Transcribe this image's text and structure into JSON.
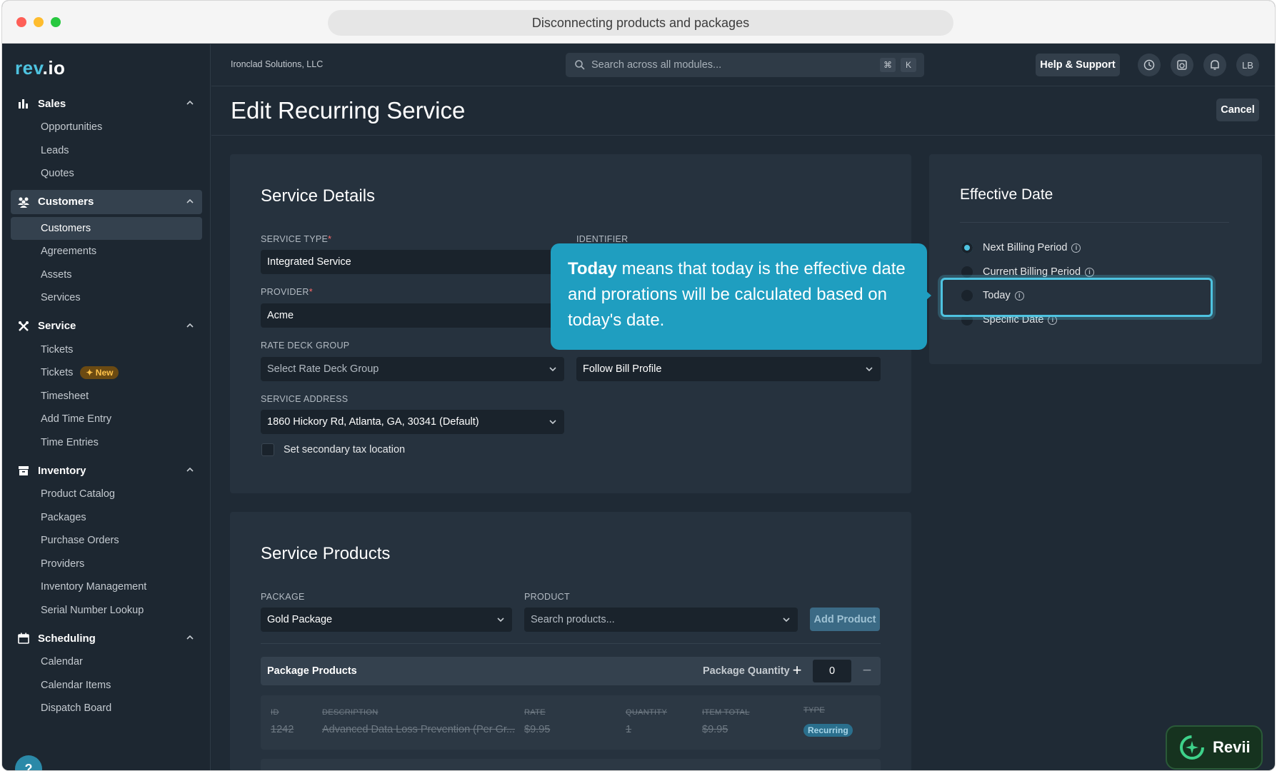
{
  "window": {
    "title": "Disconnecting products and packages"
  },
  "brand": {
    "logo_text_a": "rev",
    "logo_text_b": ".io"
  },
  "sidebar": {
    "sections": [
      {
        "label": "Sales",
        "icon": "bar-chart-icon",
        "items": [
          "Opportunities",
          "Leads",
          "Quotes"
        ]
      },
      {
        "label": "Customers",
        "icon": "users-icon",
        "items": [
          "Customers",
          "Agreements",
          "Assets",
          "Services"
        ]
      },
      {
        "label": "Service",
        "icon": "tools-icon",
        "items": [
          "Tickets",
          "Tickets",
          "Timesheet",
          "Add Time Entry",
          "Time Entries"
        ],
        "new_badge": "New"
      },
      {
        "label": "Inventory",
        "icon": "box-icon",
        "items": [
          "Product Catalog",
          "Packages",
          "Purchase Orders",
          "Providers",
          "Inventory Management",
          "Serial Number Lookup"
        ]
      },
      {
        "label": "Scheduling",
        "icon": "calendar-icon",
        "items": [
          "Calendar",
          "Calendar Items",
          "Dispatch Board"
        ]
      }
    ],
    "help_fab": "?"
  },
  "topbar": {
    "company": "Ironclad Solutions, LLC",
    "search_placeholder": "Search across all modules...",
    "kbd_cmd": "⌘",
    "kbd_k": "K",
    "help_label": "Help & Support",
    "avatar_initials": "LB"
  },
  "page": {
    "title": "Edit Recurring Service",
    "cancel_label": "Cancel"
  },
  "service_details": {
    "title": "Service Details",
    "service_type_label": "SERVICE TYPE",
    "service_type_value": "Integrated Service",
    "identifier_label": "IDENTIFIER",
    "provider_label": "PROVIDER",
    "provider_value": "Acme",
    "rate_deck_label": "RATE DECK GROUP",
    "rate_deck_placeholder": "Select Rate Deck Group",
    "bill_profile_value": "Follow Bill Profile",
    "address_label": "SERVICE ADDRESS",
    "address_value": "1860 Hickory Rd, Atlanta, GA, 30341 (Default)",
    "secondary_tax_label": "Set secondary tax location",
    "required_mark": "*"
  },
  "effective_date": {
    "title": "Effective Date",
    "options": [
      "Next Billing Period",
      "Current Billing Period",
      "Today",
      "Specific Date"
    ],
    "selected_index": 0
  },
  "tooltip": {
    "bold": "Today",
    "text": " means that today is the effective date and prorations will be calculated based on today's date."
  },
  "service_products": {
    "title": "Service Products",
    "package_label": "PACKAGE",
    "package_value": "Gold Package",
    "product_label": "PRODUCT",
    "product_placeholder": "Search products...",
    "add_product_label": "Add Product",
    "package_products_title": "Package Products",
    "package_quantity_label": "Package Quantity",
    "package_quantity_value": "0",
    "columns": [
      "ID",
      "DESCRIPTION",
      "RATE",
      "QUANTITY",
      "ITEM TOTAL",
      "TYPE"
    ],
    "row": {
      "id": "1242",
      "description": "Advanced Data Loss Prevention (Per Gr...",
      "rate": "$9.95",
      "quantity": "1",
      "item_total": "$9.95",
      "type": "Recurring"
    }
  },
  "assistant": {
    "label": "Revii"
  },
  "colors": {
    "accent": "#4ec3e0",
    "tooltip": "#1f9ec0",
    "background": "#1f2a35"
  }
}
